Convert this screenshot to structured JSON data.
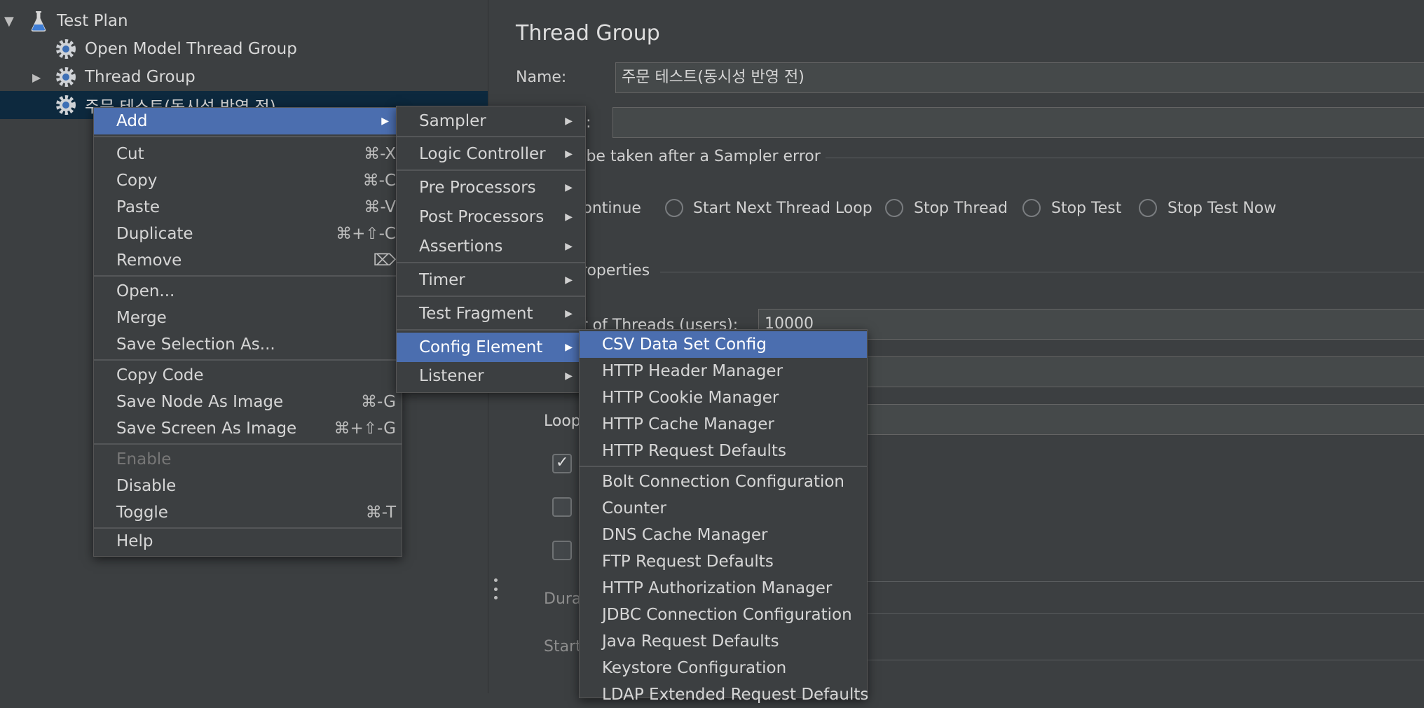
{
  "tree": {
    "items": [
      {
        "label": "Test Plan",
        "icon": "flask-icon",
        "expanded": true
      },
      {
        "label": "Open Model Thread Group",
        "icon": "gear-icon"
      },
      {
        "label": "Thread Group",
        "icon": "gear-icon",
        "expanded": false
      },
      {
        "label": "주문 테스트(동시성 반영 전)",
        "icon": "gear-icon",
        "selected": true
      }
    ]
  },
  "right": {
    "title": "Thread Group",
    "name_label": "Name:",
    "name_value": "주문 테스트(동시성 반영 전)",
    "comments_label": "ts:",
    "comments_value": "",
    "action_label": "o be taken after a Sampler error",
    "actions": [
      "Continue",
      "Start Next Thread Loop",
      "Stop Thread",
      "Stop Test",
      "Stop Test Now"
    ],
    "properties_label": "Properties",
    "threads_label": "er of Threads (users):",
    "threads_value": "10000",
    "loop_label": "Loop",
    "duration_label": "Dura",
    "startup_label": "Start"
  },
  "context_menu": {
    "items": [
      {
        "label": "Add",
        "submenu": true,
        "active": true
      },
      {
        "label": "Cut",
        "shortcut": "⌘-X"
      },
      {
        "label": "Copy",
        "shortcut": "⌘-C"
      },
      {
        "label": "Paste",
        "shortcut": "⌘-V"
      },
      {
        "label": "Duplicate",
        "shortcut": "⌘+⇧-C"
      },
      {
        "label": "Remove",
        "shortcut": "⌦"
      },
      {
        "label": "Open..."
      },
      {
        "label": "Merge"
      },
      {
        "label": "Save Selection As..."
      },
      {
        "label": "Copy Code"
      },
      {
        "label": "Save Node As Image",
        "shortcut": "⌘-G"
      },
      {
        "label": "Save Screen As Image",
        "shortcut": "⌘+⇧-G"
      },
      {
        "label": "Enable",
        "disabled": true
      },
      {
        "label": "Disable"
      },
      {
        "label": "Toggle",
        "shortcut": "⌘-T"
      },
      {
        "label": "Help"
      }
    ]
  },
  "add_menu": {
    "items": [
      {
        "label": "Sampler"
      },
      {
        "label": "Logic Controller"
      },
      {
        "label": "Pre Processors"
      },
      {
        "label": "Post Processors"
      },
      {
        "label": "Assertions"
      },
      {
        "label": "Timer"
      },
      {
        "label": "Test Fragment"
      },
      {
        "label": "Config Element",
        "active": true
      },
      {
        "label": "Listener"
      }
    ]
  },
  "config_menu": {
    "items": [
      {
        "label": "CSV Data Set Config",
        "active": true
      },
      {
        "label": "HTTP Header Manager"
      },
      {
        "label": "HTTP Cookie Manager"
      },
      {
        "label": "HTTP Cache Manager"
      },
      {
        "label": "HTTP Request Defaults"
      },
      {
        "label": "Bolt Connection Configuration"
      },
      {
        "label": "Counter"
      },
      {
        "label": "DNS Cache Manager"
      },
      {
        "label": "FTP Request Defaults"
      },
      {
        "label": "HTTP Authorization Manager"
      },
      {
        "label": "JDBC Connection Configuration"
      },
      {
        "label": "Java Request Defaults"
      },
      {
        "label": "Keystore Configuration"
      },
      {
        "label": "LDAP Extended Request Defaults"
      }
    ]
  },
  "colors": {
    "background": "#3c3f41",
    "menu_highlight": "#4b6eaf",
    "selection": "#0d293e",
    "text": "#d6d6d6"
  }
}
